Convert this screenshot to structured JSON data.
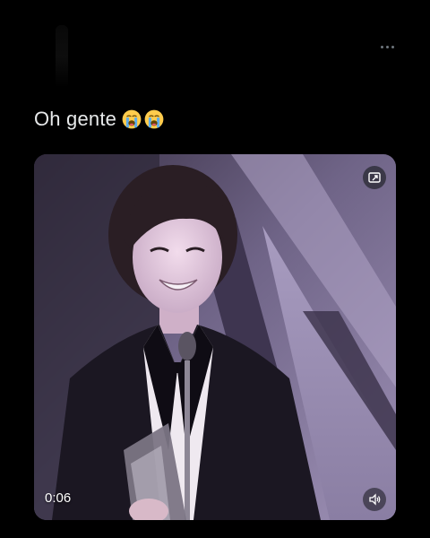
{
  "tweet": {
    "text": "Oh gente",
    "emojis": [
      "loudly-crying-face-icon",
      "loudly-crying-face-icon"
    ]
  },
  "media": {
    "type": "video",
    "elapsed_time": "0:06",
    "icons": {
      "picture_in_picture": "picture-in-picture-icon",
      "volume": "volume-icon"
    }
  },
  "header": {
    "more_icon": "more-options-icon"
  },
  "colors": {
    "background": "#000000",
    "text": "#e7e9ea",
    "icon_gray": "#6e767d",
    "stage_purple": "#8f82a6"
  }
}
